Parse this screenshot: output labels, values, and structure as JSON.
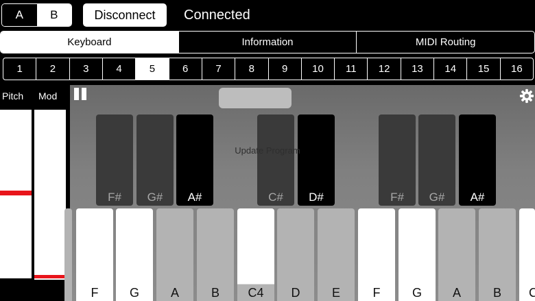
{
  "top": {
    "seg_a": "A",
    "seg_b": "B",
    "disconnect": "Disconnect",
    "status": "Connected"
  },
  "tabs": [
    "Keyboard",
    "Information",
    "MIDI Routing"
  ],
  "channels": [
    "1",
    "2",
    "3",
    "4",
    "5",
    "6",
    "7",
    "8",
    "9",
    "10",
    "11",
    "12",
    "13",
    "14",
    "15",
    "16"
  ],
  "selected_channel": "5",
  "wheels": {
    "pitch_label": "Pitch",
    "mod_label": "Mod"
  },
  "overlay_text": "Update Program",
  "black_keys": [
    "F#",
    "G#",
    "A#",
    "C#",
    "D#",
    "F#",
    "G#",
    "A#"
  ],
  "white_keys": [
    "F",
    "G",
    "A",
    "B",
    "C4",
    "D",
    "E",
    "F",
    "G",
    "A",
    "B",
    "C"
  ],
  "colors": {
    "accent_red": "#e8151b",
    "key_area": "#808080"
  },
  "icons": {
    "pause": "pause-icon",
    "settings": "gear-icon"
  }
}
